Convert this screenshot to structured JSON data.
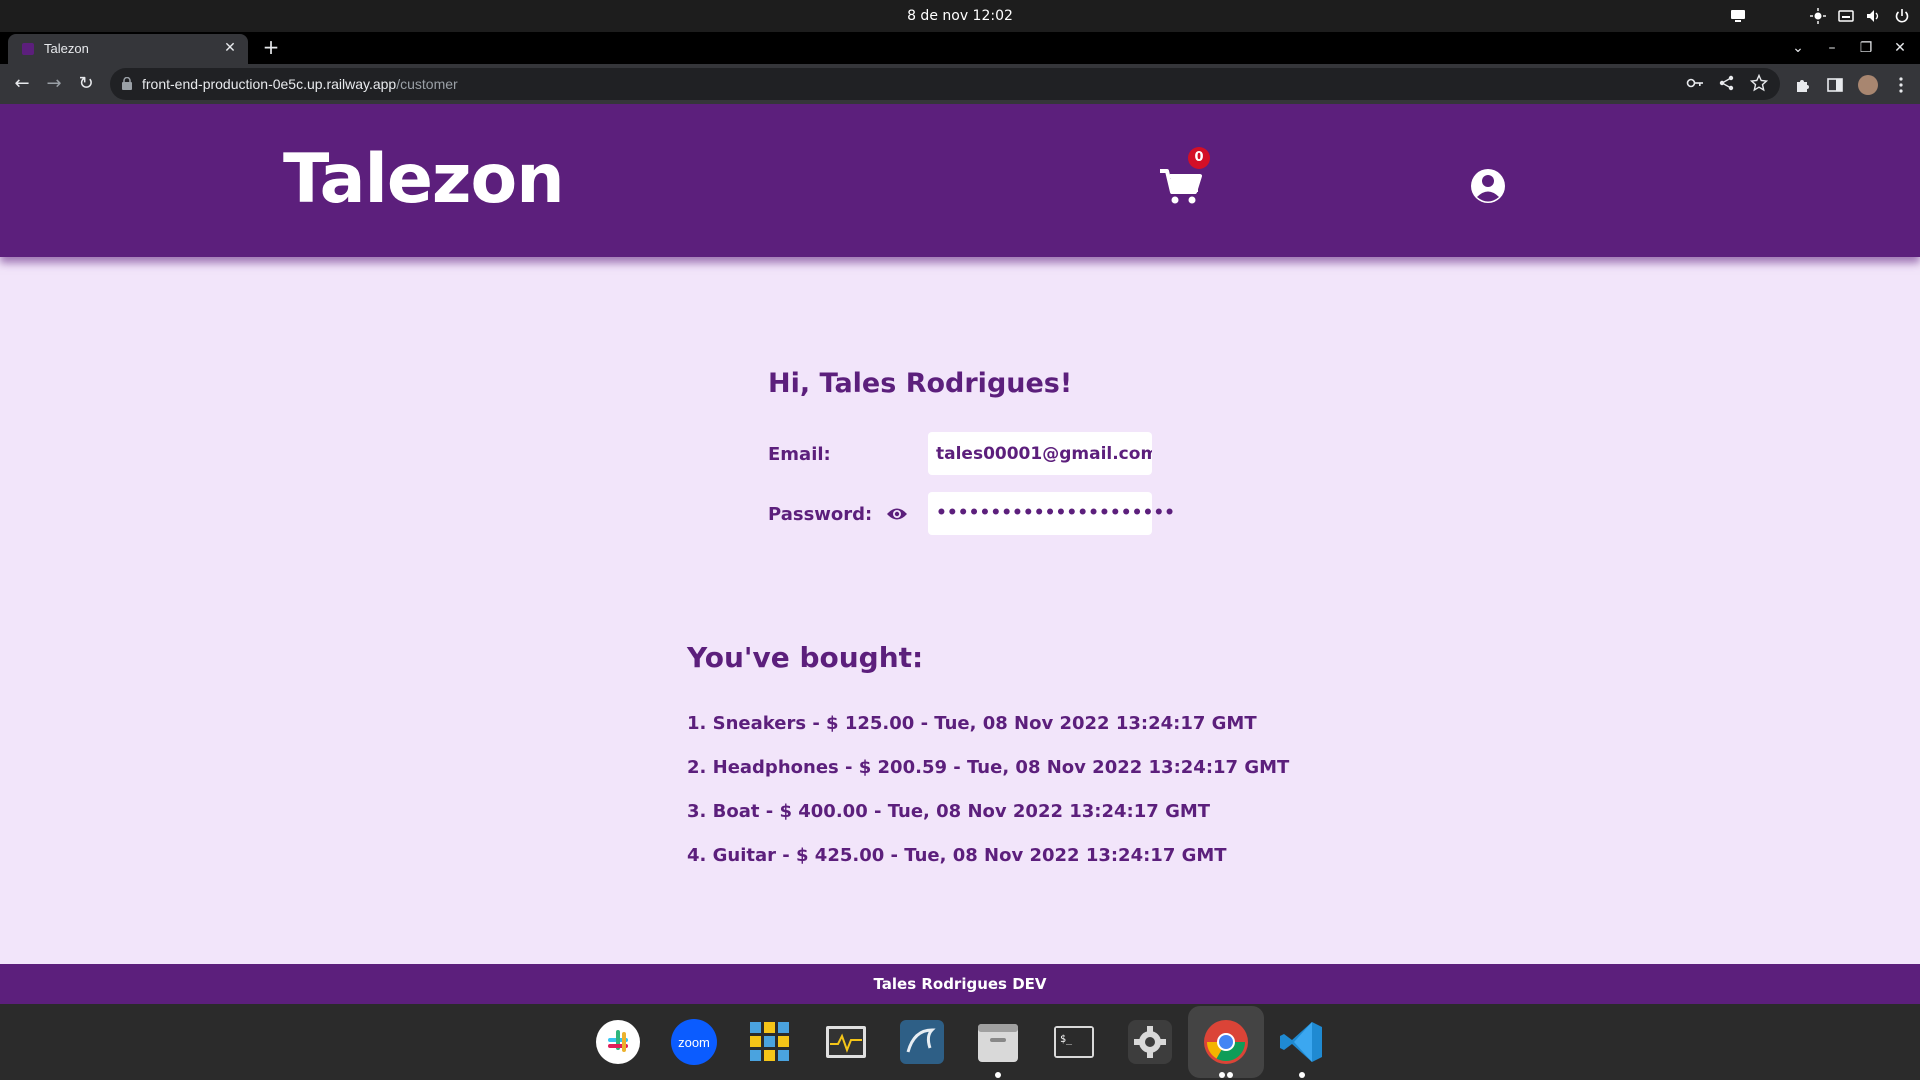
{
  "system": {
    "clock": "8 de nov  12:02",
    "tray_icons": [
      "display-icon",
      "brightness-icon",
      "keyboard-icon",
      "volume-icon",
      "power-icon"
    ]
  },
  "browser": {
    "tab_title": "Talezon",
    "url_host": "front-end-production-0e5c.up.railway.app",
    "url_path": "/customer"
  },
  "app": {
    "logo": "Talezon",
    "cart_count": "0",
    "greeting": "Hi, Tales Rodrigues!",
    "email_label": "Email:",
    "email_value": "tales00001@gmail.com",
    "password_label": "Password:",
    "password_value": "••••••••••••••••••••••",
    "bought_title": "You've bought:",
    "orders": [
      "1. Sneakers - $ 125.00 - Tue, 08 Nov 2022 13:24:17 GMT",
      "2. Headphones - $ 200.59 - Tue, 08 Nov 2022 13:24:17 GMT",
      "3. Boat - $ 400.00 - Tue, 08 Nov 2022 13:24:17 GMT",
      "4. Guitar - $ 425.00 - Tue, 08 Nov 2022 13:24:17 GMT"
    ],
    "footer": "Tales Rodrigues DEV"
  },
  "colors": {
    "brand_purple": "#5c1f7c",
    "page_bg": "#f2e5fa",
    "badge_red": "#d30f27"
  },
  "dock": [
    "slack-icon",
    "zoom-icon",
    "app-grid-icon",
    "system-monitor-icon",
    "mysql-workbench-icon",
    "files-icon",
    "terminal-icon",
    "settings-icon",
    "chrome-icon",
    "vscode-icon"
  ]
}
